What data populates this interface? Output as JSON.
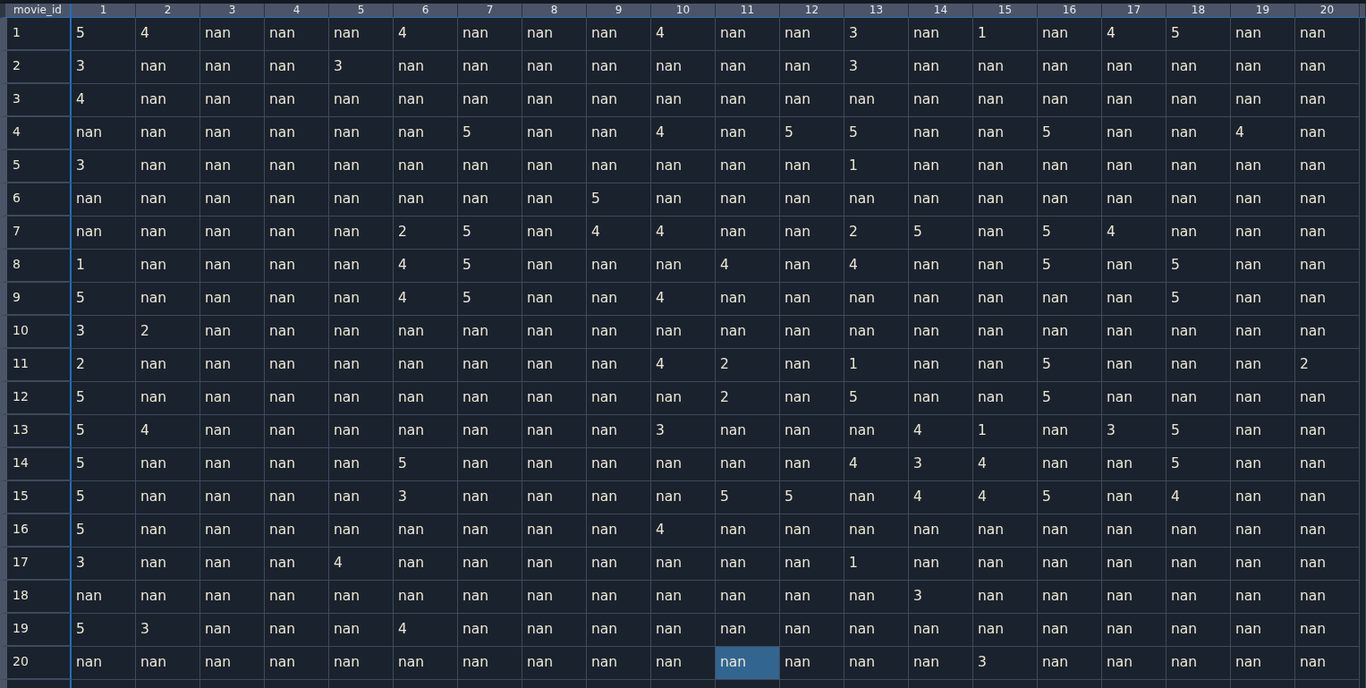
{
  "index_header": "movie_id",
  "columns": [
    "1",
    "2",
    "3",
    "4",
    "5",
    "6",
    "7",
    "8",
    "9",
    "10",
    "11",
    "12",
    "13",
    "14",
    "15",
    "16",
    "17",
    "18",
    "19",
    "20"
  ],
  "rows": [
    {
      "id": "1",
      "cells": [
        {
          "text": "5",
          "selected": false
        },
        {
          "text": "4",
          "selected": false
        },
        {
          "text": "nan",
          "selected": false
        },
        {
          "text": "nan",
          "selected": false
        },
        {
          "text": "nan",
          "selected": false
        },
        {
          "text": "4",
          "selected": false
        },
        {
          "text": "nan",
          "selected": false
        },
        {
          "text": "nan",
          "selected": false
        },
        {
          "text": "nan",
          "selected": false
        },
        {
          "text": "4",
          "selected": false
        },
        {
          "text": "nan",
          "selected": false
        },
        {
          "text": "nan",
          "selected": false
        },
        {
          "text": "3",
          "selected": false
        },
        {
          "text": "nan",
          "selected": false
        },
        {
          "text": "1",
          "selected": false
        },
        {
          "text": "nan",
          "selected": false
        },
        {
          "text": "4",
          "selected": false
        },
        {
          "text": "5",
          "selected": false
        },
        {
          "text": "nan",
          "selected": false
        },
        {
          "text": "nan",
          "selected": false
        }
      ]
    },
    {
      "id": "2",
      "cells": [
        {
          "text": "3",
          "selected": false
        },
        {
          "text": "nan",
          "selected": false
        },
        {
          "text": "nan",
          "selected": false
        },
        {
          "text": "nan",
          "selected": false
        },
        {
          "text": "3",
          "selected": false
        },
        {
          "text": "nan",
          "selected": false
        },
        {
          "text": "nan",
          "selected": false
        },
        {
          "text": "nan",
          "selected": false
        },
        {
          "text": "nan",
          "selected": false
        },
        {
          "text": "nan",
          "selected": false
        },
        {
          "text": "nan",
          "selected": false
        },
        {
          "text": "nan",
          "selected": false
        },
        {
          "text": "3",
          "selected": false
        },
        {
          "text": "nan",
          "selected": false
        },
        {
          "text": "nan",
          "selected": false
        },
        {
          "text": "nan",
          "selected": false
        },
        {
          "text": "nan",
          "selected": false
        },
        {
          "text": "nan",
          "selected": false
        },
        {
          "text": "nan",
          "selected": false
        },
        {
          "text": "nan",
          "selected": false
        }
      ]
    },
    {
      "id": "3",
      "cells": [
        {
          "text": "4",
          "selected": false
        },
        {
          "text": "nan",
          "selected": false
        },
        {
          "text": "nan",
          "selected": false
        },
        {
          "text": "nan",
          "selected": false
        },
        {
          "text": "nan",
          "selected": false
        },
        {
          "text": "nan",
          "selected": false
        },
        {
          "text": "nan",
          "selected": false
        },
        {
          "text": "nan",
          "selected": false
        },
        {
          "text": "nan",
          "selected": false
        },
        {
          "text": "nan",
          "selected": false
        },
        {
          "text": "nan",
          "selected": false
        },
        {
          "text": "nan",
          "selected": false
        },
        {
          "text": "nan",
          "selected": false
        },
        {
          "text": "nan",
          "selected": false
        },
        {
          "text": "nan",
          "selected": false
        },
        {
          "text": "nan",
          "selected": false
        },
        {
          "text": "nan",
          "selected": false
        },
        {
          "text": "nan",
          "selected": false
        },
        {
          "text": "nan",
          "selected": false
        },
        {
          "text": "nan",
          "selected": false
        }
      ]
    },
    {
      "id": "4",
      "cells": [
        {
          "text": "nan",
          "selected": false
        },
        {
          "text": "nan",
          "selected": false
        },
        {
          "text": "nan",
          "selected": false
        },
        {
          "text": "nan",
          "selected": false
        },
        {
          "text": "nan",
          "selected": false
        },
        {
          "text": "nan",
          "selected": false
        },
        {
          "text": "5",
          "selected": false
        },
        {
          "text": "nan",
          "selected": false
        },
        {
          "text": "nan",
          "selected": false
        },
        {
          "text": "4",
          "selected": false
        },
        {
          "text": "nan",
          "selected": false
        },
        {
          "text": "5",
          "selected": false
        },
        {
          "text": "5",
          "selected": false
        },
        {
          "text": "nan",
          "selected": false
        },
        {
          "text": "nan",
          "selected": false
        },
        {
          "text": "5",
          "selected": false
        },
        {
          "text": "nan",
          "selected": false
        },
        {
          "text": "nan",
          "selected": false
        },
        {
          "text": "4",
          "selected": false
        },
        {
          "text": "nan",
          "selected": false
        }
      ]
    },
    {
      "id": "5",
      "cells": [
        {
          "text": "3",
          "selected": false
        },
        {
          "text": "nan",
          "selected": false
        },
        {
          "text": "nan",
          "selected": false
        },
        {
          "text": "nan",
          "selected": false
        },
        {
          "text": "nan",
          "selected": false
        },
        {
          "text": "nan",
          "selected": false
        },
        {
          "text": "nan",
          "selected": false
        },
        {
          "text": "nan",
          "selected": false
        },
        {
          "text": "nan",
          "selected": false
        },
        {
          "text": "nan",
          "selected": false
        },
        {
          "text": "nan",
          "selected": false
        },
        {
          "text": "nan",
          "selected": false
        },
        {
          "text": "1",
          "selected": false
        },
        {
          "text": "nan",
          "selected": false
        },
        {
          "text": "nan",
          "selected": false
        },
        {
          "text": "nan",
          "selected": false
        },
        {
          "text": "nan",
          "selected": false
        },
        {
          "text": "nan",
          "selected": false
        },
        {
          "text": "nan",
          "selected": false
        },
        {
          "text": "nan",
          "selected": false
        }
      ]
    },
    {
      "id": "6",
      "cells": [
        {
          "text": "nan",
          "selected": false
        },
        {
          "text": "nan",
          "selected": false
        },
        {
          "text": "nan",
          "selected": false
        },
        {
          "text": "nan",
          "selected": false
        },
        {
          "text": "nan",
          "selected": false
        },
        {
          "text": "nan",
          "selected": false
        },
        {
          "text": "nan",
          "selected": false
        },
        {
          "text": "nan",
          "selected": false
        },
        {
          "text": "5",
          "selected": false
        },
        {
          "text": "nan",
          "selected": false
        },
        {
          "text": "nan",
          "selected": false
        },
        {
          "text": "nan",
          "selected": false
        },
        {
          "text": "nan",
          "selected": false
        },
        {
          "text": "nan",
          "selected": false
        },
        {
          "text": "nan",
          "selected": false
        },
        {
          "text": "nan",
          "selected": false
        },
        {
          "text": "nan",
          "selected": false
        },
        {
          "text": "nan",
          "selected": false
        },
        {
          "text": "nan",
          "selected": false
        },
        {
          "text": "nan",
          "selected": false
        }
      ]
    },
    {
      "id": "7",
      "cells": [
        {
          "text": "nan",
          "selected": false
        },
        {
          "text": "nan",
          "selected": false
        },
        {
          "text": "nan",
          "selected": false
        },
        {
          "text": "nan",
          "selected": false
        },
        {
          "text": "nan",
          "selected": false
        },
        {
          "text": "2",
          "selected": false
        },
        {
          "text": "5",
          "selected": false
        },
        {
          "text": "nan",
          "selected": false
        },
        {
          "text": "4",
          "selected": false
        },
        {
          "text": "4",
          "selected": false
        },
        {
          "text": "nan",
          "selected": false
        },
        {
          "text": "nan",
          "selected": false
        },
        {
          "text": "2",
          "selected": false
        },
        {
          "text": "5",
          "selected": false
        },
        {
          "text": "nan",
          "selected": false
        },
        {
          "text": "5",
          "selected": false
        },
        {
          "text": "4",
          "selected": false
        },
        {
          "text": "nan",
          "selected": false
        },
        {
          "text": "nan",
          "selected": false
        },
        {
          "text": "nan",
          "selected": false
        }
      ]
    },
    {
      "id": "8",
      "cells": [
        {
          "text": "1",
          "selected": false
        },
        {
          "text": "nan",
          "selected": false
        },
        {
          "text": "nan",
          "selected": false
        },
        {
          "text": "nan",
          "selected": false
        },
        {
          "text": "nan",
          "selected": false
        },
        {
          "text": "4",
          "selected": false
        },
        {
          "text": "5",
          "selected": false
        },
        {
          "text": "nan",
          "selected": false
        },
        {
          "text": "nan",
          "selected": false
        },
        {
          "text": "nan",
          "selected": false
        },
        {
          "text": "4",
          "selected": false
        },
        {
          "text": "nan",
          "selected": false
        },
        {
          "text": "4",
          "selected": false
        },
        {
          "text": "nan",
          "selected": false
        },
        {
          "text": "nan",
          "selected": false
        },
        {
          "text": "5",
          "selected": false
        },
        {
          "text": "nan",
          "selected": false
        },
        {
          "text": "5",
          "selected": false
        },
        {
          "text": "nan",
          "selected": false
        },
        {
          "text": "nan",
          "selected": false
        }
      ]
    },
    {
      "id": "9",
      "cells": [
        {
          "text": "5",
          "selected": false
        },
        {
          "text": "nan",
          "selected": false
        },
        {
          "text": "nan",
          "selected": false
        },
        {
          "text": "nan",
          "selected": false
        },
        {
          "text": "nan",
          "selected": false
        },
        {
          "text": "4",
          "selected": false
        },
        {
          "text": "5",
          "selected": false
        },
        {
          "text": "nan",
          "selected": false
        },
        {
          "text": "nan",
          "selected": false
        },
        {
          "text": "4",
          "selected": false
        },
        {
          "text": "nan",
          "selected": false
        },
        {
          "text": "nan",
          "selected": false
        },
        {
          "text": "nan",
          "selected": false
        },
        {
          "text": "nan",
          "selected": false
        },
        {
          "text": "nan",
          "selected": false
        },
        {
          "text": "nan",
          "selected": false
        },
        {
          "text": "nan",
          "selected": false
        },
        {
          "text": "5",
          "selected": false
        },
        {
          "text": "nan",
          "selected": false
        },
        {
          "text": "nan",
          "selected": false
        }
      ]
    },
    {
      "id": "10",
      "cells": [
        {
          "text": "3",
          "selected": false
        },
        {
          "text": "2",
          "selected": false
        },
        {
          "text": "nan",
          "selected": false
        },
        {
          "text": "nan",
          "selected": false
        },
        {
          "text": "nan",
          "selected": false
        },
        {
          "text": "nan",
          "selected": false
        },
        {
          "text": "nan",
          "selected": false
        },
        {
          "text": "nan",
          "selected": false
        },
        {
          "text": "nan",
          "selected": false
        },
        {
          "text": "nan",
          "selected": false
        },
        {
          "text": "nan",
          "selected": false
        },
        {
          "text": "nan",
          "selected": false
        },
        {
          "text": "nan",
          "selected": false
        },
        {
          "text": "nan",
          "selected": false
        },
        {
          "text": "nan",
          "selected": false
        },
        {
          "text": "nan",
          "selected": false
        },
        {
          "text": "nan",
          "selected": false
        },
        {
          "text": "nan",
          "selected": false
        },
        {
          "text": "nan",
          "selected": false
        },
        {
          "text": "nan",
          "selected": false
        }
      ]
    },
    {
      "id": "11",
      "cells": [
        {
          "text": "2",
          "selected": false
        },
        {
          "text": "nan",
          "selected": false
        },
        {
          "text": "nan",
          "selected": false
        },
        {
          "text": "nan",
          "selected": false
        },
        {
          "text": "nan",
          "selected": false
        },
        {
          "text": "nan",
          "selected": false
        },
        {
          "text": "nan",
          "selected": false
        },
        {
          "text": "nan",
          "selected": false
        },
        {
          "text": "nan",
          "selected": false
        },
        {
          "text": "4",
          "selected": false
        },
        {
          "text": "2",
          "selected": false
        },
        {
          "text": "nan",
          "selected": false
        },
        {
          "text": "1",
          "selected": false
        },
        {
          "text": "nan",
          "selected": false
        },
        {
          "text": "nan",
          "selected": false
        },
        {
          "text": "5",
          "selected": false
        },
        {
          "text": "nan",
          "selected": false
        },
        {
          "text": "nan",
          "selected": false
        },
        {
          "text": "nan",
          "selected": false
        },
        {
          "text": "2",
          "selected": false
        }
      ]
    },
    {
      "id": "12",
      "cells": [
        {
          "text": "5",
          "selected": false
        },
        {
          "text": "nan",
          "selected": false
        },
        {
          "text": "nan",
          "selected": false
        },
        {
          "text": "nan",
          "selected": false
        },
        {
          "text": "nan",
          "selected": false
        },
        {
          "text": "nan",
          "selected": false
        },
        {
          "text": "nan",
          "selected": false
        },
        {
          "text": "nan",
          "selected": false
        },
        {
          "text": "nan",
          "selected": false
        },
        {
          "text": "nan",
          "selected": false
        },
        {
          "text": "2",
          "selected": false
        },
        {
          "text": "nan",
          "selected": false
        },
        {
          "text": "5",
          "selected": false
        },
        {
          "text": "nan",
          "selected": false
        },
        {
          "text": "nan",
          "selected": false
        },
        {
          "text": "5",
          "selected": false
        },
        {
          "text": "nan",
          "selected": false
        },
        {
          "text": "nan",
          "selected": false
        },
        {
          "text": "nan",
          "selected": false
        },
        {
          "text": "nan",
          "selected": false
        }
      ]
    },
    {
      "id": "13",
      "cells": [
        {
          "text": "5",
          "selected": false
        },
        {
          "text": "4",
          "selected": false
        },
        {
          "text": "nan",
          "selected": false
        },
        {
          "text": "nan",
          "selected": false
        },
        {
          "text": "nan",
          "selected": false
        },
        {
          "text": "nan",
          "selected": false
        },
        {
          "text": "nan",
          "selected": false
        },
        {
          "text": "nan",
          "selected": false
        },
        {
          "text": "nan",
          "selected": false
        },
        {
          "text": "3",
          "selected": false
        },
        {
          "text": "nan",
          "selected": false
        },
        {
          "text": "nan",
          "selected": false
        },
        {
          "text": "nan",
          "selected": false
        },
        {
          "text": "4",
          "selected": false
        },
        {
          "text": "1",
          "selected": false
        },
        {
          "text": "nan",
          "selected": false
        },
        {
          "text": "3",
          "selected": false
        },
        {
          "text": "5",
          "selected": false
        },
        {
          "text": "nan",
          "selected": false
        },
        {
          "text": "nan",
          "selected": false
        }
      ]
    },
    {
      "id": "14",
      "cells": [
        {
          "text": "5",
          "selected": false
        },
        {
          "text": "nan",
          "selected": false
        },
        {
          "text": "nan",
          "selected": false
        },
        {
          "text": "nan",
          "selected": false
        },
        {
          "text": "nan",
          "selected": false
        },
        {
          "text": "5",
          "selected": false
        },
        {
          "text": "nan",
          "selected": false
        },
        {
          "text": "nan",
          "selected": false
        },
        {
          "text": "nan",
          "selected": false
        },
        {
          "text": "nan",
          "selected": false
        },
        {
          "text": "nan",
          "selected": false
        },
        {
          "text": "nan",
          "selected": false
        },
        {
          "text": "4",
          "selected": false
        },
        {
          "text": "3",
          "selected": false
        },
        {
          "text": "4",
          "selected": false
        },
        {
          "text": "nan",
          "selected": false
        },
        {
          "text": "nan",
          "selected": false
        },
        {
          "text": "5",
          "selected": false
        },
        {
          "text": "nan",
          "selected": false
        },
        {
          "text": "nan",
          "selected": false
        }
      ]
    },
    {
      "id": "15",
      "cells": [
        {
          "text": "5",
          "selected": false
        },
        {
          "text": "nan",
          "selected": false
        },
        {
          "text": "nan",
          "selected": false
        },
        {
          "text": "nan",
          "selected": false
        },
        {
          "text": "nan",
          "selected": false
        },
        {
          "text": "3",
          "selected": false
        },
        {
          "text": "nan",
          "selected": false
        },
        {
          "text": "nan",
          "selected": false
        },
        {
          "text": "nan",
          "selected": false
        },
        {
          "text": "nan",
          "selected": false
        },
        {
          "text": "5",
          "selected": false
        },
        {
          "text": "5",
          "selected": false
        },
        {
          "text": "nan",
          "selected": false
        },
        {
          "text": "4",
          "selected": false
        },
        {
          "text": "4",
          "selected": false
        },
        {
          "text": "5",
          "selected": false
        },
        {
          "text": "nan",
          "selected": false
        },
        {
          "text": "4",
          "selected": false
        },
        {
          "text": "nan",
          "selected": false
        },
        {
          "text": "nan",
          "selected": false
        }
      ]
    },
    {
      "id": "16",
      "cells": [
        {
          "text": "5",
          "selected": false
        },
        {
          "text": "nan",
          "selected": false
        },
        {
          "text": "nan",
          "selected": false
        },
        {
          "text": "nan",
          "selected": false
        },
        {
          "text": "nan",
          "selected": false
        },
        {
          "text": "nan",
          "selected": false
        },
        {
          "text": "nan",
          "selected": false
        },
        {
          "text": "nan",
          "selected": false
        },
        {
          "text": "nan",
          "selected": false
        },
        {
          "text": "4",
          "selected": false
        },
        {
          "text": "nan",
          "selected": false
        },
        {
          "text": "nan",
          "selected": false
        },
        {
          "text": "nan",
          "selected": false
        },
        {
          "text": "nan",
          "selected": false
        },
        {
          "text": "nan",
          "selected": false
        },
        {
          "text": "nan",
          "selected": false
        },
        {
          "text": "nan",
          "selected": false
        },
        {
          "text": "nan",
          "selected": false
        },
        {
          "text": "nan",
          "selected": false
        },
        {
          "text": "nan",
          "selected": false
        }
      ]
    },
    {
      "id": "17",
      "cells": [
        {
          "text": "3",
          "selected": false
        },
        {
          "text": "nan",
          "selected": false
        },
        {
          "text": "nan",
          "selected": false
        },
        {
          "text": "nan",
          "selected": false
        },
        {
          "text": "4",
          "selected": false
        },
        {
          "text": "nan",
          "selected": false
        },
        {
          "text": "nan",
          "selected": false
        },
        {
          "text": "nan",
          "selected": false
        },
        {
          "text": "nan",
          "selected": false
        },
        {
          "text": "nan",
          "selected": false
        },
        {
          "text": "nan",
          "selected": false
        },
        {
          "text": "nan",
          "selected": false
        },
        {
          "text": "1",
          "selected": false
        },
        {
          "text": "nan",
          "selected": false
        },
        {
          "text": "nan",
          "selected": false
        },
        {
          "text": "nan",
          "selected": false
        },
        {
          "text": "nan",
          "selected": false
        },
        {
          "text": "nan",
          "selected": false
        },
        {
          "text": "nan",
          "selected": false
        },
        {
          "text": "nan",
          "selected": false
        }
      ]
    },
    {
      "id": "18",
      "cells": [
        {
          "text": "nan",
          "selected": false
        },
        {
          "text": "nan",
          "selected": false
        },
        {
          "text": "nan",
          "selected": false
        },
        {
          "text": "nan",
          "selected": false
        },
        {
          "text": "nan",
          "selected": false
        },
        {
          "text": "nan",
          "selected": false
        },
        {
          "text": "nan",
          "selected": false
        },
        {
          "text": "nan",
          "selected": false
        },
        {
          "text": "nan",
          "selected": false
        },
        {
          "text": "nan",
          "selected": false
        },
        {
          "text": "nan",
          "selected": false
        },
        {
          "text": "nan",
          "selected": false
        },
        {
          "text": "nan",
          "selected": false
        },
        {
          "text": "3",
          "selected": false
        },
        {
          "text": "nan",
          "selected": false
        },
        {
          "text": "nan",
          "selected": false
        },
        {
          "text": "nan",
          "selected": false
        },
        {
          "text": "nan",
          "selected": false
        },
        {
          "text": "nan",
          "selected": false
        },
        {
          "text": "nan",
          "selected": false
        }
      ]
    },
    {
      "id": "19",
      "cells": [
        {
          "text": "5",
          "selected": false
        },
        {
          "text": "3",
          "selected": false
        },
        {
          "text": "nan",
          "selected": false
        },
        {
          "text": "nan",
          "selected": false
        },
        {
          "text": "nan",
          "selected": false
        },
        {
          "text": "4",
          "selected": false
        },
        {
          "text": "nan",
          "selected": false
        },
        {
          "text": "nan",
          "selected": false
        },
        {
          "text": "nan",
          "selected": false
        },
        {
          "text": "nan",
          "selected": false
        },
        {
          "text": "nan",
          "selected": false
        },
        {
          "text": "nan",
          "selected": false
        },
        {
          "text": "nan",
          "selected": false
        },
        {
          "text": "nan",
          "selected": false
        },
        {
          "text": "nan",
          "selected": false
        },
        {
          "text": "nan",
          "selected": false
        },
        {
          "text": "nan",
          "selected": false
        },
        {
          "text": "nan",
          "selected": false
        },
        {
          "text": "nan",
          "selected": false
        },
        {
          "text": "nan",
          "selected": false
        }
      ]
    },
    {
      "id": "20",
      "cells": [
        {
          "text": "nan",
          "selected": false
        },
        {
          "text": "nan",
          "selected": false
        },
        {
          "text": "nan",
          "selected": false
        },
        {
          "text": "nan",
          "selected": false
        },
        {
          "text": "nan",
          "selected": false
        },
        {
          "text": "nan",
          "selected": false
        },
        {
          "text": "nan",
          "selected": false
        },
        {
          "text": "nan",
          "selected": false
        },
        {
          "text": "nan",
          "selected": false
        },
        {
          "text": "nan",
          "selected": false
        },
        {
          "text": "nan",
          "selected": true
        },
        {
          "text": "nan",
          "selected": false
        },
        {
          "text": "nan",
          "selected": false
        },
        {
          "text": "nan",
          "selected": false
        },
        {
          "text": "3",
          "selected": false
        },
        {
          "text": "nan",
          "selected": false
        },
        {
          "text": "nan",
          "selected": false
        },
        {
          "text": "nan",
          "selected": false
        },
        {
          "text": "nan",
          "selected": false
        },
        {
          "text": "nan",
          "selected": false
        }
      ]
    }
  ]
}
